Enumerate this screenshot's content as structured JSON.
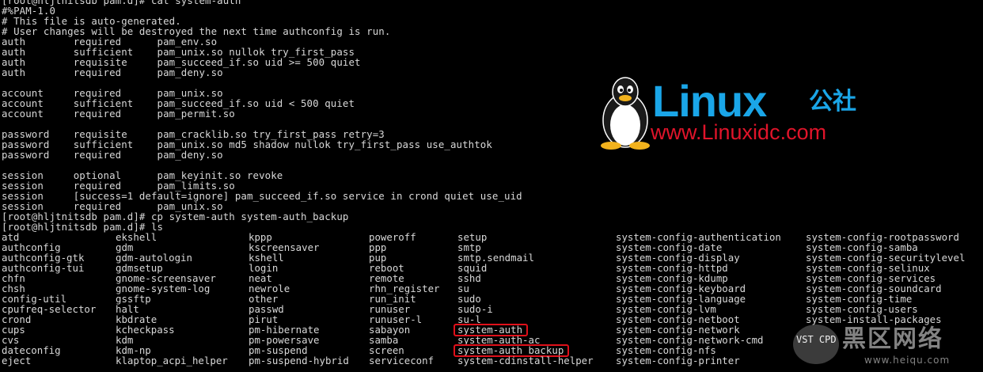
{
  "terminal": {
    "header_lines": [
      "[root@hljtnitsdb pam.d]# cat system-auth",
      "#%PAM-1.0",
      "# This file is auto-generated.",
      "# User changes will be destroyed the next time authconfig is run.",
      "auth        required      pam_env.so",
      "auth        sufficient    pam_unix.so nullok try_first_pass",
      "auth        requisite     pam_succeed_if.so uid >= 500 quiet",
      "auth        required      pam_deny.so",
      "",
      "account     required      pam_unix.so",
      "account     sufficient    pam_succeed_if.so uid < 500 quiet",
      "account     required      pam_permit.so",
      "",
      "password    requisite     pam_cracklib.so try_first_pass retry=3",
      "password    sufficient    pam_unix.so md5 shadow nullok try_first_pass use_authtok",
      "password    required      pam_deny.so",
      "",
      "session     optional      pam_keyinit.so revoke",
      "session     required      pam_limits.so",
      "session     [success=1 default=ignore] pam_succeed_if.so service in crond quiet use_uid",
      "session     required      pam_unix.so",
      "[root@hljtnitsdb pam.d]# cp system-auth system-auth_backup",
      "[root@hljtnitsdb pam.d]# ls"
    ],
    "ls_columns": [
      [
        "atd",
        "authconfig",
        "authconfig-gtk",
        "authconfig-tui",
        "chfn",
        "chsh",
        "config-util",
        "cpufreq-selector",
        "crond",
        "cups",
        "cvs",
        "dateconfig",
        "eject"
      ],
      [
        "ekshell",
        "gdm",
        "gdm-autologin",
        "gdmsetup",
        "gnome-screensaver",
        "gnome-system-log",
        "gssftp",
        "halt",
        "kbdrate",
        "kcheckpass",
        "kdm",
        "kdm-np",
        "klaptop_acpi_helper"
      ],
      [
        "kppp",
        "kscreensaver",
        "kshell",
        "login",
        "neat",
        "newrole",
        "other",
        "passwd",
        "pirut",
        "pm-hibernate",
        "pm-powersave",
        "pm-suspend",
        "pm-suspend-hybrid"
      ],
      [
        "poweroff",
        "ppp",
        "pup",
        "reboot",
        "remote",
        "rhn_register",
        "run_init",
        "runuser",
        "runuser-l",
        "sabayon",
        "samba",
        "screen",
        "serviceconf"
      ],
      [
        "setup",
        "smtp",
        "smtp.sendmail",
        "squid",
        "sshd",
        "su",
        "sudo",
        "sudo-i",
        "su-l",
        "system-auth",
        "system-auth-ac",
        "system-auth_backup",
        "system-cdinstall-helper"
      ],
      [
        "system-config-authentication",
        "system-config-date",
        "system-config-display",
        "system-config-httpd",
        "system-config-kdump",
        "system-config-keyboard",
        "system-config-language",
        "system-config-lvm",
        "system-config-netboot",
        "system-config-network",
        "system-config-network-cmd",
        "system-config-nfs",
        "system-config-printer"
      ],
      [
        "system-config-rootpassword",
        "system-config-samba",
        "system-config-securitylevel",
        "system-config-selinux",
        "system-config-services",
        "system-config-soundcard",
        "system-config-time",
        "system-config-users",
        "system-install-packages",
        "",
        "",
        "",
        ""
      ]
    ],
    "highlighted_entries": [
      "system-auth",
      "system-auth_backup"
    ]
  },
  "logo": {
    "brand": "Linux",
    "chinese": "公社",
    "url": "www.Linuxidc.com",
    "brand_color": "#1aa6e8",
    "url_color": "#e0142a",
    "icon": "tux-penguin-icon"
  },
  "watermark": {
    "badge": "VST CPD",
    "chinese": "黑区网络",
    "url": "www.heiqu.com"
  },
  "colors": {
    "background": "#000000",
    "text": "#d8d8d8",
    "highlight_box": "#e0101a"
  }
}
